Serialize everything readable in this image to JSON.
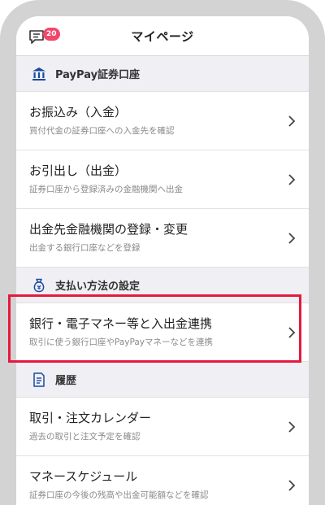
{
  "header": {
    "title": "マイページ",
    "badge_count": "20",
    "message_icon": "chat-bubble-icon"
  },
  "sections": [
    {
      "label": "PayPay証券口座",
      "icon": "bank-building-icon",
      "items": [
        {
          "title": "お振込み（入金）",
          "subtitle": "買付代金の証券口座への入金先を確認"
        },
        {
          "title": "お引出し（出金）",
          "subtitle": "証券口座から登録済みの金融機関へ出金"
        },
        {
          "title": "出金先金融機関の登録・変更",
          "subtitle": "出金する銀行口座などを登録"
        }
      ]
    },
    {
      "label": "支払い方法の設定",
      "icon": "money-bag-icon",
      "items": [
        {
          "title": "銀行・電子マネー等と入出金連携",
          "subtitle": "取引に使う銀行口座やPayPayマネーなどを連携"
        }
      ]
    },
    {
      "label": "履歴",
      "icon": "document-icon",
      "items": [
        {
          "title": "取引・注文カレンダー",
          "subtitle": "過去の取引と注文予定を確認"
        },
        {
          "title": "マネースケジュール",
          "subtitle": "証券口座の今後の残高や出金可能額などを確認"
        }
      ]
    }
  ],
  "colors": {
    "badge": "#f2466b",
    "icon_blue": "#1a4aa0",
    "highlight": "#e6193c",
    "section_bg": "#efeff4"
  }
}
